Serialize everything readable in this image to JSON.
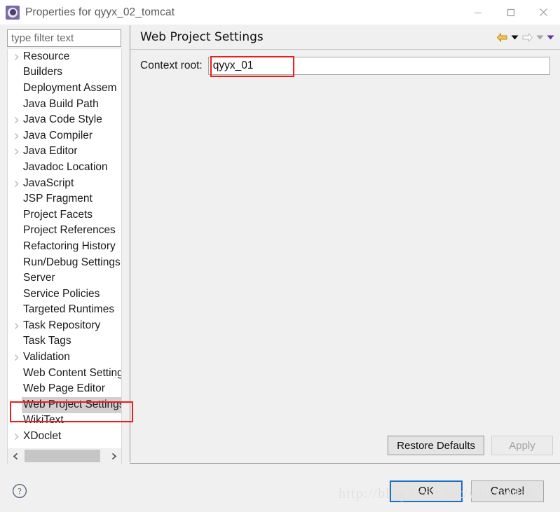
{
  "window": {
    "title": "Properties for qyyx_02_tomcat",
    "icon": "properties-gear-icon",
    "controls": {
      "minimize": "minimize-icon",
      "maximize": "maximize-icon",
      "close": "close-icon"
    }
  },
  "filter": {
    "placeholder": "type filter text",
    "value": ""
  },
  "tree": {
    "selected": "Web Project Settings",
    "items": [
      {
        "label": "Resource",
        "expandable": true
      },
      {
        "label": "Builders",
        "expandable": false
      },
      {
        "label": "Deployment Assem",
        "expandable": false
      },
      {
        "label": "Java Build Path",
        "expandable": false
      },
      {
        "label": "Java Code Style",
        "expandable": true
      },
      {
        "label": "Java Compiler",
        "expandable": true
      },
      {
        "label": "Java Editor",
        "expandable": true
      },
      {
        "label": "Javadoc Location",
        "expandable": false
      },
      {
        "label": "JavaScript",
        "expandable": true
      },
      {
        "label": "JSP Fragment",
        "expandable": false
      },
      {
        "label": "Project Facets",
        "expandable": false
      },
      {
        "label": "Project References",
        "expandable": false
      },
      {
        "label": "Refactoring History",
        "expandable": false
      },
      {
        "label": "Run/Debug Settings",
        "expandable": false
      },
      {
        "label": "Server",
        "expandable": false
      },
      {
        "label": "Service Policies",
        "expandable": false
      },
      {
        "label": "Targeted Runtimes",
        "expandable": false
      },
      {
        "label": "Task Repository",
        "expandable": true
      },
      {
        "label": "Task Tags",
        "expandable": false
      },
      {
        "label": "Validation",
        "expandable": true
      },
      {
        "label": "Web Content Settings",
        "expandable": false
      },
      {
        "label": "Web Page Editor",
        "expandable": false
      },
      {
        "label": "Web Project Settings",
        "expandable": false
      },
      {
        "label": "WikiText",
        "expandable": false
      },
      {
        "label": "XDoclet",
        "expandable": true
      }
    ],
    "scrollbar": {
      "left_arrow": "chevron-left-icon",
      "right_arrow": "chevron-right-icon"
    }
  },
  "content": {
    "title": "Web Project Settings",
    "nav": {
      "back": "back-arrow-icon",
      "back_menu": "dropdown-triangle-icon",
      "forward": "forward-arrow-icon",
      "forward_menu": "dropdown-triangle-icon",
      "menu": "view-menu-triangle-icon"
    },
    "context_root": {
      "label": "Context root:",
      "value": "qyyx_01"
    },
    "buttons": {
      "restore_defaults": "Restore Defaults",
      "apply": "Apply",
      "apply_disabled": true
    }
  },
  "footer": {
    "help": "help-icon",
    "ok": "OK",
    "cancel": "Cancel"
  },
  "watermark": {
    "text": "http://blog.csdn.net/wuxinidrh"
  },
  "colors": {
    "annotation": "#ee1c1c",
    "default_button_border": "#1a6fc4",
    "panel_bg": "#f0f0f0",
    "selection": "#d0d0d0",
    "back_arrow": "#e0a02a",
    "menu_triangle": "#6b2fa0"
  }
}
